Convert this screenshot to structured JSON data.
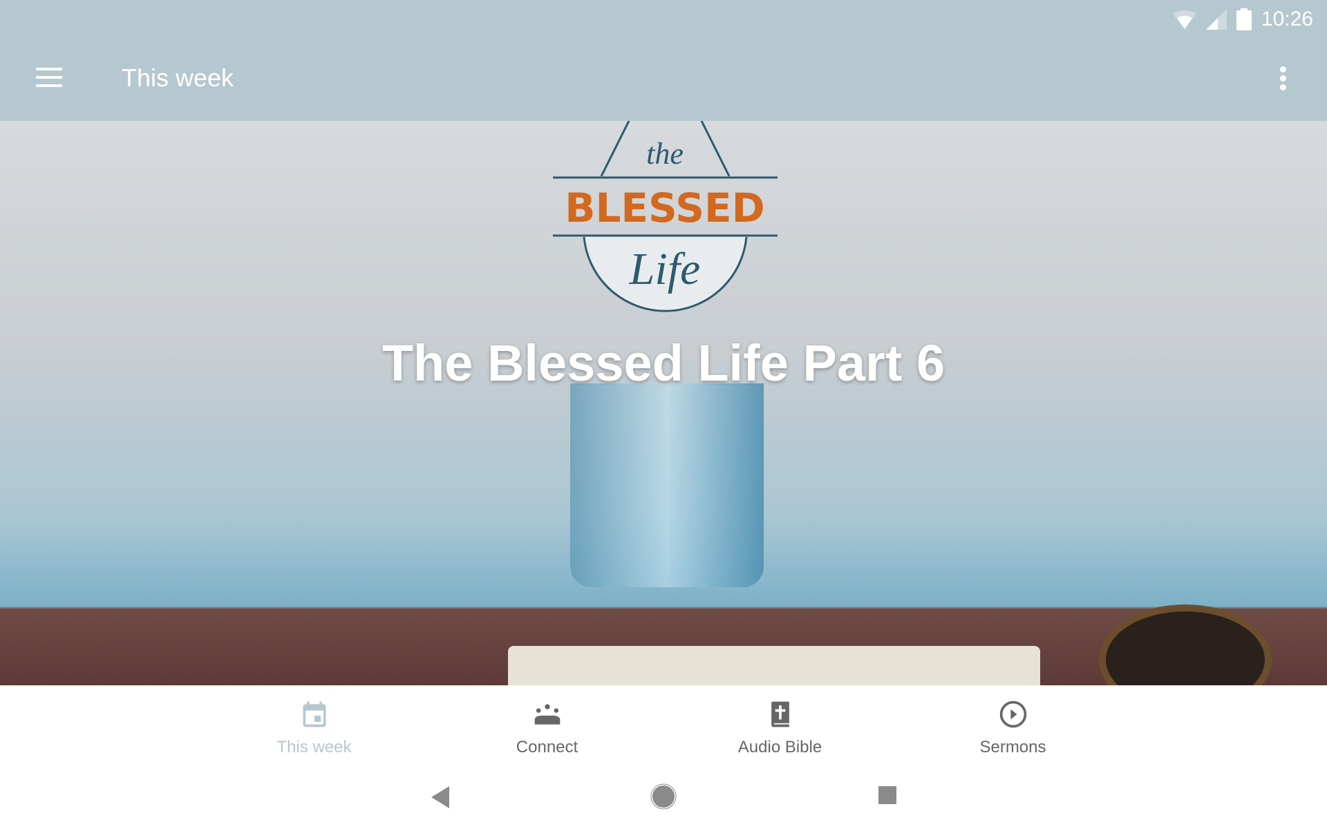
{
  "status_bar": {
    "time": "10:26",
    "icons": [
      "wifi-icon",
      "signal-icon",
      "battery-icon"
    ]
  },
  "app_bar": {
    "title": "This week",
    "menu_icon": "hamburger-menu-icon",
    "overflow_icon": "more-vert-icon"
  },
  "hero": {
    "title": "The Blessed Life Part 6",
    "logo": {
      "line1": "the",
      "line2": "BLESSED",
      "line3": "Life"
    },
    "logo_accent": "#d2691e"
  },
  "bottom_nav": {
    "items": [
      {
        "label": "This week",
        "icon": "calendar-icon",
        "active": true
      },
      {
        "label": "Connect",
        "icon": "groups-icon",
        "active": false
      },
      {
        "label": "Audio Bible",
        "icon": "bible-icon",
        "active": false
      },
      {
        "label": "Sermons",
        "icon": "play-circle-icon",
        "active": false
      }
    ]
  },
  "colors": {
    "app_bar": "#b5c8cf",
    "inactive": "#666666",
    "active": "#b5c8cf"
  }
}
